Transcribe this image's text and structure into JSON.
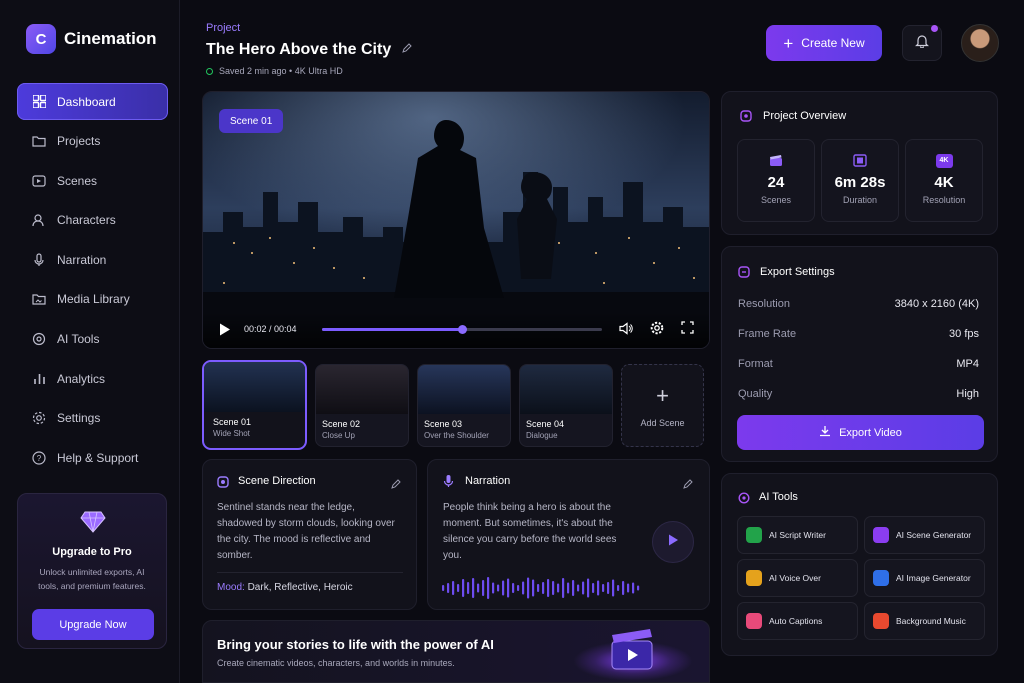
{
  "app": {
    "name": "Cinemation",
    "logo_letter": "C"
  },
  "header": {
    "eyebrow": "Project",
    "title": "The Hero Above the City",
    "status": "Saved 2 min ago • 4K Ultra HD",
    "create_label": "Create New"
  },
  "sidebar": {
    "items": [
      {
        "label": "Dashboard",
        "icon": "grid-icon"
      },
      {
        "label": "Projects",
        "icon": "folder-icon"
      },
      {
        "label": "Scenes",
        "icon": "film-icon"
      },
      {
        "label": "Characters",
        "icon": "users-icon"
      },
      {
        "label": "Narration",
        "icon": "mic-icon"
      },
      {
        "label": "Media Library",
        "icon": "media-icon"
      },
      {
        "label": "AI Tools",
        "icon": "ai-icon"
      },
      {
        "label": "Analytics",
        "icon": "chart-icon"
      },
      {
        "label": "Settings",
        "icon": "gear-icon"
      },
      {
        "label": "Help & Support",
        "icon": "help-icon"
      }
    ],
    "upgrade": {
      "title": "Upgrade to Pro",
      "text": "Unlock unlimited exports, AI tools, and premium features.",
      "button": "Upgrade Now"
    }
  },
  "player": {
    "scene_badge": "Scene 01",
    "time": "00:02 / 00:04",
    "progress": 0.5
  },
  "scenes": [
    {
      "title": "Scene 01",
      "sub": "Wide Shot"
    },
    {
      "title": "Scene 02",
      "sub": "Close Up"
    },
    {
      "title": "Scene 03",
      "sub": "Over the Shoulder"
    },
    {
      "title": "Scene 04",
      "sub": "Dialogue"
    }
  ],
  "add_scene": "Add Scene",
  "direction": {
    "title": "Scene Direction",
    "text": "Sentinel stands near the ledge, shadowed by storm clouds, looking over the city. The mood is reflective and somber.",
    "mood_label": "Mood:",
    "mood_value": "Dark, Reflective, Heroic"
  },
  "narration": {
    "title": "Narration",
    "text": "People think being a hero is about the moment. But sometimes, it's about the silence you carry before the world sees you."
  },
  "banner": {
    "title": "Bring your stories to life with the power of AI",
    "sub": "Create cinematic videos, characters, and worlds in minutes."
  },
  "overview": {
    "title": "Project Overview",
    "stats": [
      {
        "value": "24",
        "label": "Scenes",
        "icon": "clapper-icon"
      },
      {
        "value": "6m 28s",
        "label": "Duration",
        "icon": "film-frame-icon"
      },
      {
        "value": "4K",
        "label": "Resolution",
        "icon": "4k-icon",
        "icon_text": "4K"
      }
    ]
  },
  "export": {
    "title": "Export Settings",
    "rows": [
      {
        "label": "Resolution",
        "value": "3840 x 2160 (4K)"
      },
      {
        "label": "Frame Rate",
        "value": "30 fps"
      },
      {
        "label": "Format",
        "value": "MP4"
      },
      {
        "label": "Quality",
        "value": "High"
      }
    ],
    "button": "Export Video"
  },
  "ai_tools": {
    "title": "AI Tools",
    "items": [
      {
        "label": "AI Script Writer",
        "color": "#22a34a"
      },
      {
        "label": "AI Scene Generator",
        "color": "#8b3df0"
      },
      {
        "label": "AI Voice Over",
        "color": "#e5a21c"
      },
      {
        "label": "AI Image Generator",
        "color": "#2f6fe8"
      },
      {
        "label": "Auto Captions",
        "color": "#e84a7a"
      },
      {
        "label": "Background Music",
        "color": "#e8492f"
      }
    ]
  },
  "colors": {
    "accent": "#6d4cf0",
    "bg": "#0b0b12",
    "panel": "#12121b"
  }
}
